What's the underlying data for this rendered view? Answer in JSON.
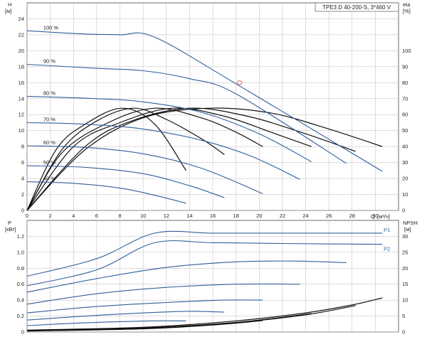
{
  "chart_data": [
    {
      "type": "line",
      "title": "TPE3 D 40-200-S, 3*460 V",
      "xlabel": "",
      "ylabel": "H",
      "ylabel_unit": "[м]",
      "y2label": "eta",
      "y2label_unit": "[%]",
      "xlim": [
        0,
        32
      ],
      "ylim": [
        0,
        26
      ],
      "y2lim": [
        0,
        130
      ],
      "x_ticks": [
        "0",
        "2",
        "4",
        "6",
        "8",
        "10",
        "12",
        "14",
        "16",
        "18",
        "20",
        "22",
        "24",
        "26",
        "28",
        "30"
      ],
      "y_ticks": [
        "0",
        "2",
        "4",
        "6",
        "8",
        "10",
        "12",
        "14",
        "16",
        "18",
        "20",
        "22",
        "24"
      ],
      "y2_ticks": [
        "0",
        "10",
        "20",
        "30",
        "40",
        "50",
        "60",
        "70",
        "80",
        "90",
        "100"
      ],
      "x_label_text": "Q",
      "x_label_unit": "[м³/ч]",
      "grid": true,
      "series": [
        {
          "name": "100 %",
          "x": [
            0,
            5,
            8,
            11,
            18.3,
            30.6
          ],
          "y": [
            22.5,
            22.1,
            22.0,
            21.7,
            15.6,
            4.9
          ]
        },
        {
          "name": "90 %",
          "x": [
            0,
            6,
            10,
            14,
            18,
            27.5
          ],
          "y": [
            18.3,
            17.8,
            17.5,
            16.5,
            14.6,
            5.9
          ]
        },
        {
          "name": "80 %",
          "x": [
            0,
            6,
            10,
            15,
            20,
            24.5
          ],
          "y": [
            14.3,
            14.0,
            13.6,
            12.3,
            9.6,
            6.1
          ]
        },
        {
          "name": "70 %",
          "x": [
            0,
            5,
            10,
            15,
            19.3,
            23.5
          ],
          "y": [
            11.0,
            10.8,
            10.2,
            8.8,
            6.8,
            3.9
          ]
        },
        {
          "name": "60 %",
          "x": [
            0,
            5,
            10,
            15,
            20.3
          ],
          "y": [
            8.1,
            7.9,
            7.1,
            5.3,
            2.1
          ]
        },
        {
          "name": "50 %",
          "x": [
            0,
            5,
            10,
            14,
            17
          ],
          "y": [
            5.6,
            5.4,
            4.6,
            3.1,
            1.6
          ]
        },
        {
          "name": "40 %",
          "x": [
            0,
            4,
            8,
            11,
            13.7
          ],
          "y": [
            3.6,
            3.4,
            2.8,
            1.9,
            0.9
          ]
        }
      ],
      "eff_curves": [
        {
          "x": [
            0,
            5,
            10,
            15.6,
            21,
            26,
            30.6
          ],
          "y": [
            0,
            38,
            58,
            64,
            61,
            51,
            40
          ]
        },
        {
          "x": [
            0,
            5,
            9,
            14.0,
            19,
            24,
            28.3
          ],
          "y": [
            0,
            40,
            56,
            64,
            59,
            48,
            37
          ]
        },
        {
          "x": [
            0,
            4,
            8,
            12.5,
            17,
            21,
            24.5
          ],
          "y": [
            0,
            40,
            55,
            64,
            59,
            49,
            40
          ]
        },
        {
          "x": [
            0,
            3,
            7,
            11.0,
            15,
            18,
            20.3
          ],
          "y": [
            0,
            36,
            55,
            64,
            58,
            49,
            40
          ]
        },
        {
          "x": [
            0,
            3,
            6,
            9.2,
            12,
            15,
            17
          ],
          "y": [
            0,
            38,
            56,
            64,
            57,
            45,
            35
          ]
        },
        {
          "x": [
            0,
            2.5,
            5,
            8.2,
            11,
            13.7
          ],
          "y": [
            0,
            38,
            54,
            64,
            54,
            25
          ]
        }
      ],
      "duty_point": {
        "x": 18.3,
        "y": 16
      }
    },
    {
      "type": "line",
      "ylabel": "P",
      "ylabel_unit": "[кВт]",
      "y2label": "NPSH",
      "y2label_unit": "[м]",
      "xlim": [
        0,
        32
      ],
      "ylim": [
        0,
        1.4
      ],
      "y2lim": [
        0,
        35
      ],
      "y_ticks": [
        "0",
        "0.2",
        "0.4",
        "0.6",
        "0.8",
        "1.0",
        "1.2"
      ],
      "y2_ticks": [
        "0",
        "5",
        "10",
        "15",
        "20",
        "25",
        "30"
      ],
      "grid": true,
      "series": [
        {
          "name": "P1",
          "x": [
            0,
            6,
            11,
            16,
            22,
            30.6
          ],
          "y": [
            0.7,
            0.92,
            1.24,
            1.24,
            1.24,
            1.24
          ]
        },
        {
          "name": "P2",
          "x": [
            0,
            6,
            11,
            16,
            22,
            30.6
          ],
          "y": [
            0.58,
            0.78,
            1.12,
            1.12,
            1.11,
            1.1
          ]
        },
        {
          "name": "",
          "x": [
            0,
            6,
            12,
            18,
            23,
            27.5
          ],
          "y": [
            0.5,
            0.67,
            0.81,
            0.88,
            0.89,
            0.87
          ]
        },
        {
          "name": "",
          "x": [
            0,
            6,
            12,
            18,
            23.5
          ],
          "y": [
            0.35,
            0.48,
            0.56,
            0.6,
            0.6
          ]
        },
        {
          "name": "",
          "x": [
            0,
            6,
            12,
            17,
            20.3
          ],
          "y": [
            0.24,
            0.32,
            0.37,
            0.4,
            0.4
          ]
        },
        {
          "name": "",
          "x": [
            0,
            5,
            10,
            14,
            17
          ],
          "y": [
            0.15,
            0.2,
            0.24,
            0.26,
            0.25
          ]
        },
        {
          "name": "",
          "x": [
            0,
            4,
            8,
            11,
            13.7
          ],
          "y": [
            0.08,
            0.11,
            0.13,
            0.14,
            0.14
          ]
        }
      ],
      "npsh_curves": [
        {
          "x": [
            0,
            10,
            18,
            24,
            28,
            30.6
          ],
          "y2": [
            0.6,
            1.5,
            3.5,
            6.0,
            8.5,
            10.7
          ]
        },
        {
          "x": [
            0,
            10,
            18,
            24,
            28.3
          ],
          "y2": [
            0.5,
            1.3,
            3.0,
            5.4,
            8.3
          ]
        },
        {
          "x": [
            0,
            10,
            18,
            24.5
          ],
          "y2": [
            0.4,
            1.2,
            3.0,
            5.8
          ]
        },
        {
          "x": [
            0,
            10,
            16,
            20.3
          ],
          "y2": [
            0.3,
            1.0,
            2.2,
            3.6
          ]
        }
      ]
    }
  ]
}
